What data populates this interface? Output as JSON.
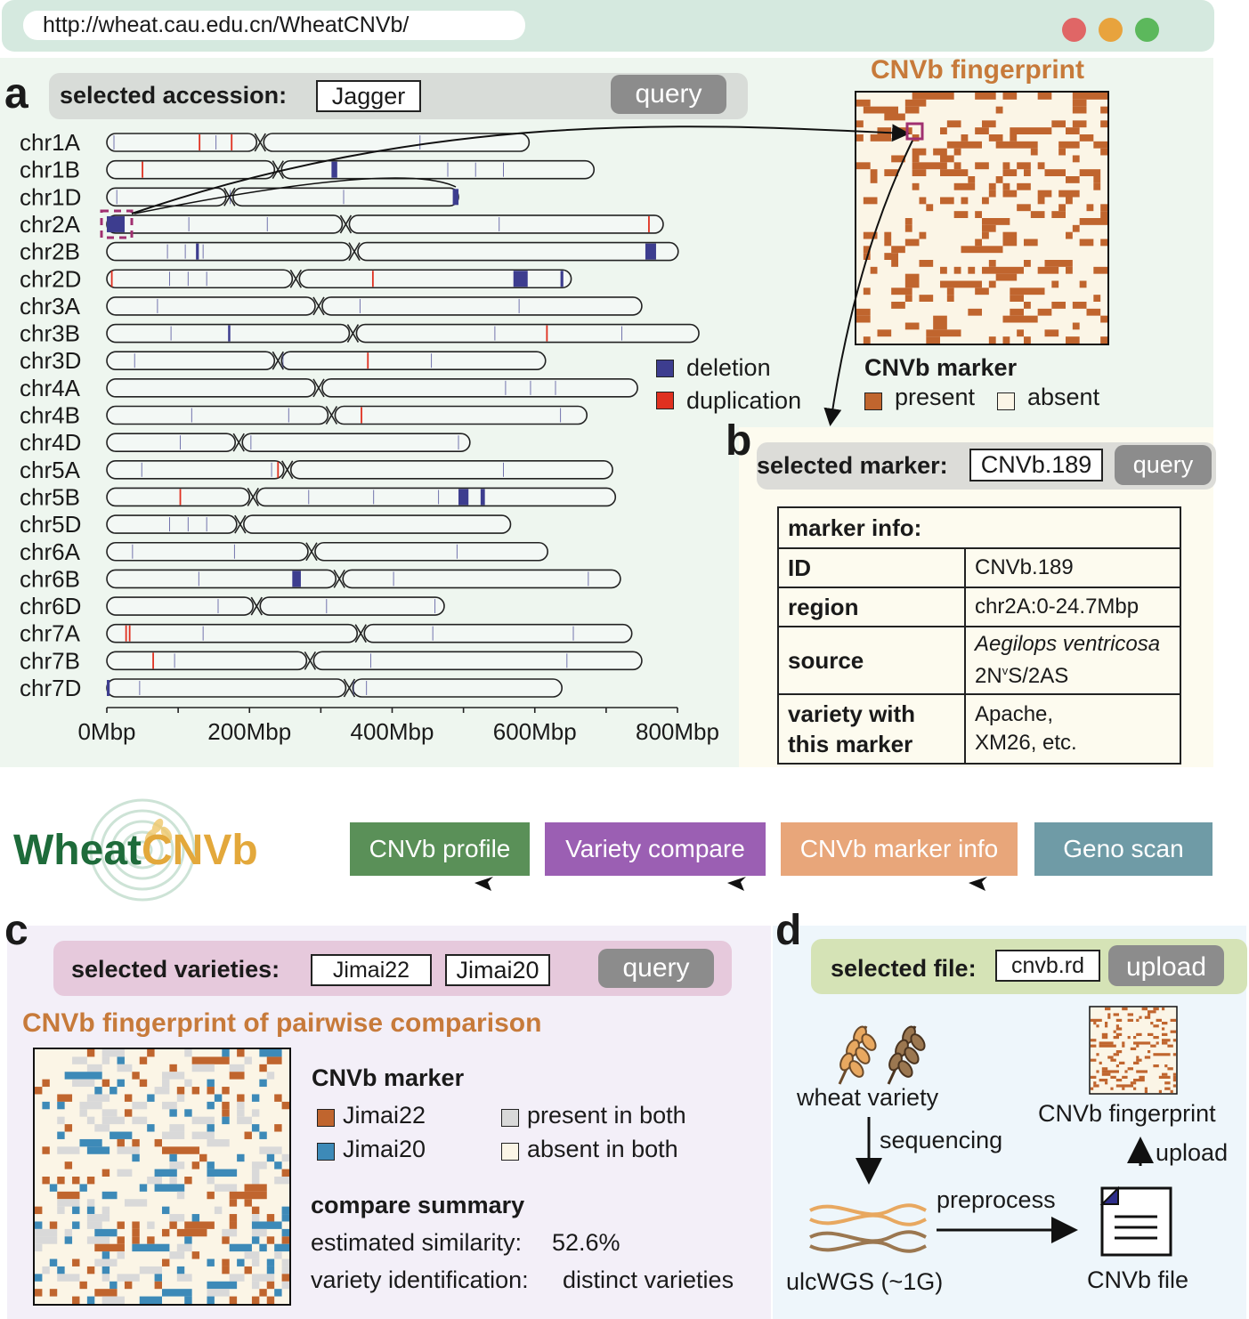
{
  "browser": {
    "url": "http://wheat.cau.edu.cn/WheatCNVb/",
    "dots": [
      "#e06666",
      "#e8a33d",
      "#5cb85c"
    ]
  },
  "panel_a": {
    "letter": "a",
    "query_label": "selected accession:",
    "accession": "Jagger",
    "query_button": "query",
    "chromosomes": [
      {
        "name": "chr1A",
        "length": 592,
        "centromere": 215,
        "deletions": [],
        "duplications": [
          130,
          175
        ]
      },
      {
        "name": "chr1B",
        "length": 683,
        "centromere": 240,
        "deletions": [
          [
            315,
            323
          ]
        ],
        "duplications": [
          50
        ]
      },
      {
        "name": "chr1D",
        "length": 493,
        "centromere": 172,
        "deletions": [
          [
            485,
            493
          ]
        ],
        "duplications": []
      },
      {
        "name": "chr2A",
        "length": 780,
        "centromere": 335,
        "deletions": [
          [
            0,
            25
          ]
        ],
        "duplications": [
          760
        ]
      },
      {
        "name": "chr2B",
        "length": 801,
        "centromere": 347,
        "deletions": [
          [
            125,
            129
          ],
          [
            755,
            770
          ]
        ],
        "duplications": []
      },
      {
        "name": "chr2D",
        "length": 651,
        "centromere": 265,
        "deletions": [
          [
            570,
            590
          ],
          [
            636,
            640
          ]
        ],
        "duplications": [
          7,
          373
        ]
      },
      {
        "name": "chr3A",
        "length": 750,
        "centromere": 297,
        "deletions": [],
        "duplications": []
      },
      {
        "name": "chr3B",
        "length": 830,
        "centromere": 345,
        "deletions": [
          [
            170,
            172
          ]
        ],
        "duplications": [
          617
        ]
      },
      {
        "name": "chr3D",
        "length": 615,
        "centromere": 240,
        "deletions": [],
        "duplications": [
          366
        ]
      },
      {
        "name": "chr4A",
        "length": 744,
        "centromere": 297,
        "deletions": [],
        "duplications": []
      },
      {
        "name": "chr4B",
        "length": 673,
        "centromere": 315,
        "deletions": [],
        "duplications": [
          357
        ]
      },
      {
        "name": "chr4D",
        "length": 509,
        "centromere": 185,
        "deletions": [],
        "duplications": []
      },
      {
        "name": "chr5A",
        "length": 709,
        "centromere": 253,
        "deletions": [],
        "duplications": [
          240
        ]
      },
      {
        "name": "chr5B",
        "length": 713,
        "centromere": 205,
        "deletions": [
          [
            493,
            507
          ],
          [
            524,
            530
          ]
        ],
        "duplications": [
          103
        ]
      },
      {
        "name": "chr5D",
        "length": 566,
        "centromere": 187,
        "deletions": [],
        "duplications": []
      },
      {
        "name": "chr6A",
        "length": 618,
        "centromere": 287,
        "deletions": [],
        "duplications": []
      },
      {
        "name": "chr6B",
        "length": 720,
        "centromere": 326,
        "deletions": [
          [
            260,
            272
          ]
        ],
        "duplications": []
      },
      {
        "name": "chr6D",
        "length": 473,
        "centromere": 210,
        "deletions": [],
        "duplications": []
      },
      {
        "name": "chr7A",
        "length": 736,
        "centromere": 356,
        "deletions": [],
        "duplications": [
          27,
          32
        ]
      },
      {
        "name": "chr7B",
        "length": 750,
        "centromere": 285,
        "deletions": [],
        "duplications": [
          65
        ]
      },
      {
        "name": "chr7D",
        "length": 638,
        "centromere": 340,
        "deletions": [
          [
            0,
            4
          ]
        ],
        "duplications": []
      }
    ],
    "axis_ticks": [
      0,
      100,
      200,
      300,
      400,
      500,
      600,
      700,
      800
    ],
    "axis_labels": [
      "0Mbp",
      "200Mbp",
      "400Mbp",
      "600Mbp",
      "800Mbp"
    ],
    "axis_label_values": [
      0,
      200,
      400,
      600,
      800
    ],
    "legend": {
      "deletion": "deletion",
      "duplication": "duplication",
      "deletion_color": "#3d3d8f",
      "duplication_color": "#e03020"
    },
    "fingerprint_title": "CNVb fingerprint",
    "marker_legend_title": "CNVb marker",
    "present_label": "present",
    "absent_label": "absent",
    "present_color": "#c0652e",
    "absent_color": "#fbf5e6"
  },
  "panel_b": {
    "letter": "b",
    "query_label": "selected marker:",
    "marker": "CNVb.189",
    "query_button": "query",
    "table_title": "marker info:",
    "rows": {
      "id_key": "ID",
      "id_val": "CNVb.189",
      "region_key": "region",
      "region_val": "chr2A:0-24.7Mbp",
      "source_key": "source",
      "source_val1": "Aegilops ventricosa",
      "source_val2_pre": "2N",
      "source_val2_sup": "v",
      "source_val2_post": "S/2AS",
      "variety_key1": "variety with",
      "variety_key2": "this marker",
      "variety_val1": "Apache,",
      "variety_val2": "XM26, etc."
    }
  },
  "nav": {
    "logo_left": "Wheat",
    "logo_right": "CNVb",
    "buttons": [
      {
        "label": "CNVb profile",
        "color": "#5a9058"
      },
      {
        "label": "Variety compare",
        "color": "#9b5fb3"
      },
      {
        "label": "CNVb marker info",
        "color": "#e8a67a"
      },
      {
        "label": "Geno scan",
        "color": "#6f9ba6"
      }
    ]
  },
  "panel_c": {
    "letter": "c",
    "query_label": "selected varieties:",
    "variety1": "Jimai22",
    "variety2": "Jimai20",
    "query_button": "query",
    "title": "CNVb fingerprint of pairwise comparison",
    "legend_title": "CNVb marker",
    "legend": [
      {
        "label": "Jimai22",
        "color": "#c0652e"
      },
      {
        "label": "Jimai20",
        "color": "#3d8ab8"
      },
      {
        "label": "present in both",
        "color": "#d9d9d9"
      },
      {
        "label": "absent in both",
        "color": "#fbf5e6"
      }
    ],
    "summary_title": "compare summary",
    "similarity_label": "estimated similarity:",
    "similarity_value": "52.6%",
    "identification_label": "variety identification:",
    "identification_value": "distinct varieties"
  },
  "panel_d": {
    "letter": "d",
    "query_label": "selected file:",
    "file": "cnvb.rd",
    "upload_button": "upload",
    "wheat_variety": "wheat variety",
    "sequencing": "sequencing",
    "ulcwgs": "ulcWGS (~1G)",
    "preprocess": "preprocess",
    "cnvb_file": "CNVb file",
    "upload": "upload",
    "fingerprint": "CNVb fingerprint"
  }
}
